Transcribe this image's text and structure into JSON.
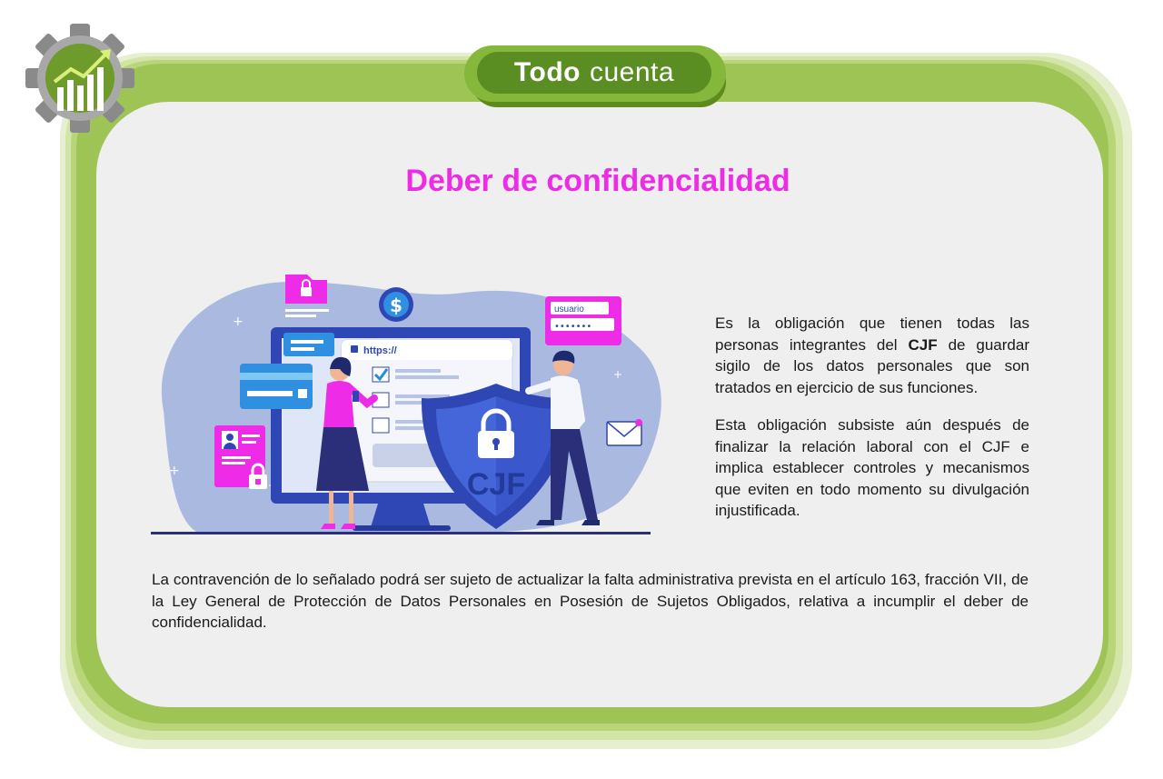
{
  "header": {
    "title_bold": "Todo",
    "title_light": "cuenta"
  },
  "main": {
    "title": "Deber de confidencialidad",
    "paragraph_1_before": "Es la obligación que tienen todas las personas integrantes del ",
    "paragraph_1_bold": "CJF",
    "paragraph_1_after": " de guardar sigilo de los datos personales que son tratados en ejercicio de sus funciones.",
    "paragraph_2": "Esta obligación subsiste aún después de finalizar la relación laboral con el CJF e implica establecer controles y mecanismos que eviten en todo  momento su divulgación injustificada.",
    "paragraph_3": "La contravención de lo señalado podrá ser sujeto de actualizar la falta administrativa prevista en el artículo 163, fracción VII, de la Ley General de Protección de Datos Personales en Posesión de Sujetos Obligados, relativa a incumplir el deber de confidencialidad."
  },
  "illustration": {
    "browser_url": "https://",
    "login_user": "usuario",
    "login_password": "•••••••",
    "shield_text": "CJF",
    "currency_symbol": "$"
  },
  "colors": {
    "frame_green": "#9fc456",
    "title_magenta": "#ee2be6",
    "pill_green": "#5a8e23",
    "panel_gray": "#efefef",
    "blob_blue": "#a9b9df",
    "shield_blue": "#2f47b4"
  },
  "icons": {
    "badge": "gear-growth-chart-icon",
    "shield": "shield-lock-icon"
  }
}
